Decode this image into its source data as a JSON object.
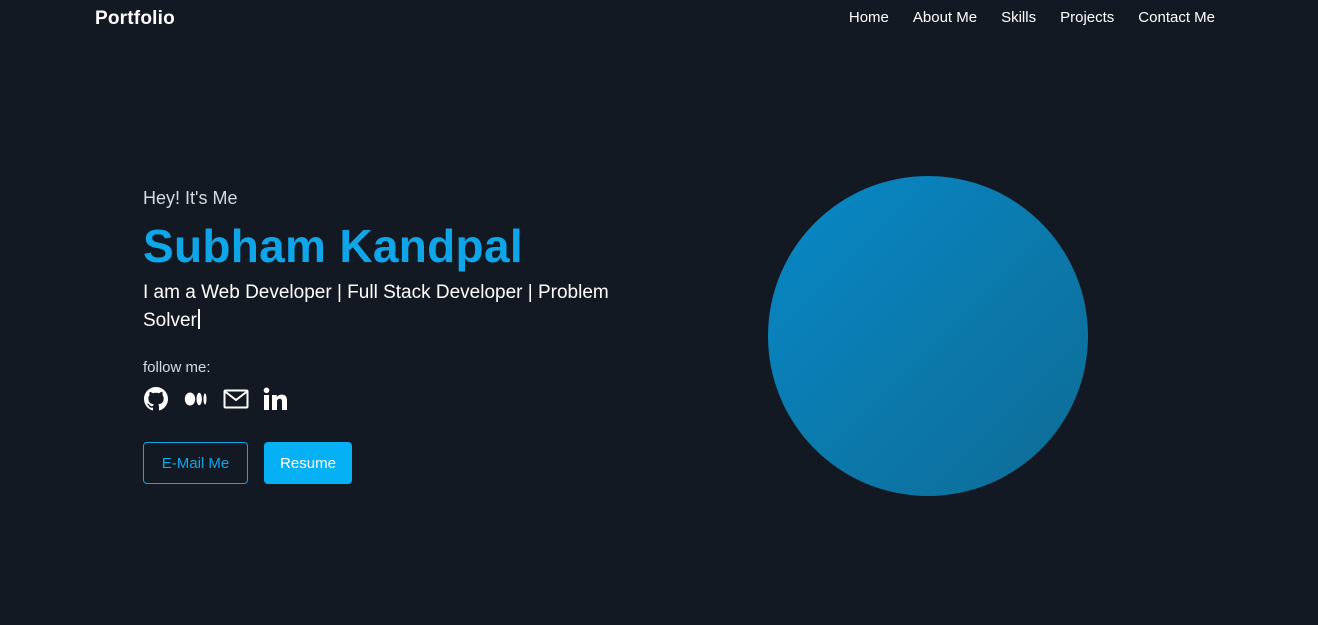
{
  "nav": {
    "brand": "Portfolio",
    "links": [
      {
        "label": "Home"
      },
      {
        "label": "About Me"
      },
      {
        "label": "Skills"
      },
      {
        "label": "Projects"
      },
      {
        "label": "Contact Me"
      }
    ]
  },
  "hero": {
    "greeting": "Hey! It's Me",
    "name": "Subham Kandpal",
    "tagline": "I am a Web Developer | Full Stack Developer | Problem Solver",
    "follow_label": "follow me:",
    "socials": [
      {
        "icon": "github-icon"
      },
      {
        "icon": "medium-icon"
      },
      {
        "icon": "mail-icon"
      },
      {
        "icon": "linkedin-icon"
      }
    ],
    "buttons": {
      "email_label": "E-Mail Me",
      "resume_label": "Resume"
    }
  },
  "colors": {
    "background": "#131922",
    "accent": "#0ea5e9",
    "avatar_gradient_start": "#0788c7",
    "avatar_gradient_end": "#0e6b95"
  }
}
